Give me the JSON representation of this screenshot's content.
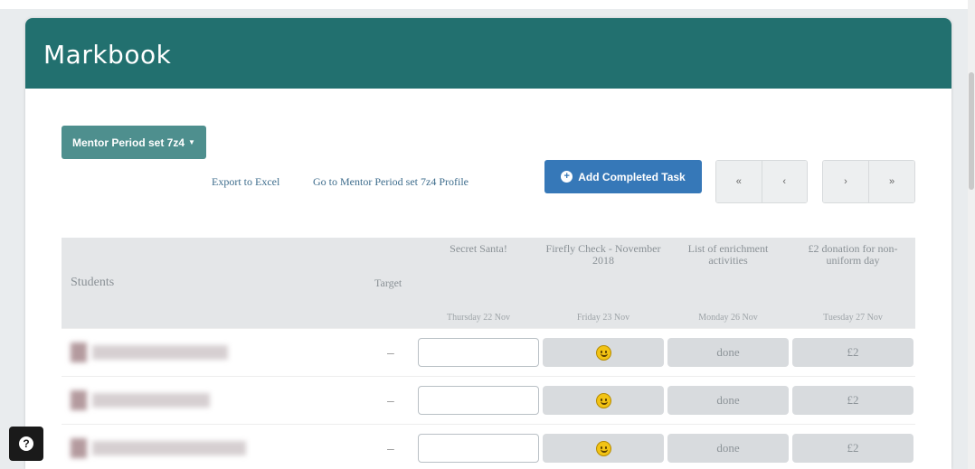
{
  "header": {
    "title": "Markbook"
  },
  "toolbar": {
    "set_dropdown": "Mentor Period set 7z4",
    "export_link": "Export to Excel",
    "profile_link": "Go to Mentor Period set 7z4 Profile",
    "add_task": "Add Completed Task",
    "pager": {
      "first": "«",
      "prev": "‹",
      "next": "›",
      "last": "»"
    }
  },
  "table": {
    "headers": {
      "students": "Students",
      "target": "Target",
      "tasks": [
        {
          "name": "Secret Santa!",
          "date": "Thursday 22 Nov"
        },
        {
          "name": "Firefly Check - November 2018",
          "date": "Friday 23 Nov"
        },
        {
          "name": "List of enrichment activities",
          "date": "Monday 26 Nov"
        },
        {
          "name": "£2 donation for non-uniform day",
          "date": "Tuesday 27 Nov"
        }
      ]
    },
    "rows": [
      {
        "target": "–",
        "firefly_icon": "smiley-icon",
        "enrichment": "done",
        "donation": "£2"
      },
      {
        "target": "–",
        "firefly_icon": "smiley-icon",
        "enrichment": "done",
        "donation": "£2"
      },
      {
        "target": "–",
        "firefly_icon": "smiley-icon",
        "enrichment": "done",
        "donation": "£2"
      }
    ]
  },
  "help": {
    "icon": "question-icon",
    "label": "?"
  },
  "colors": {
    "header": "#22706f",
    "dropdown": "#4e8f8e",
    "primary": "#3678b8"
  }
}
